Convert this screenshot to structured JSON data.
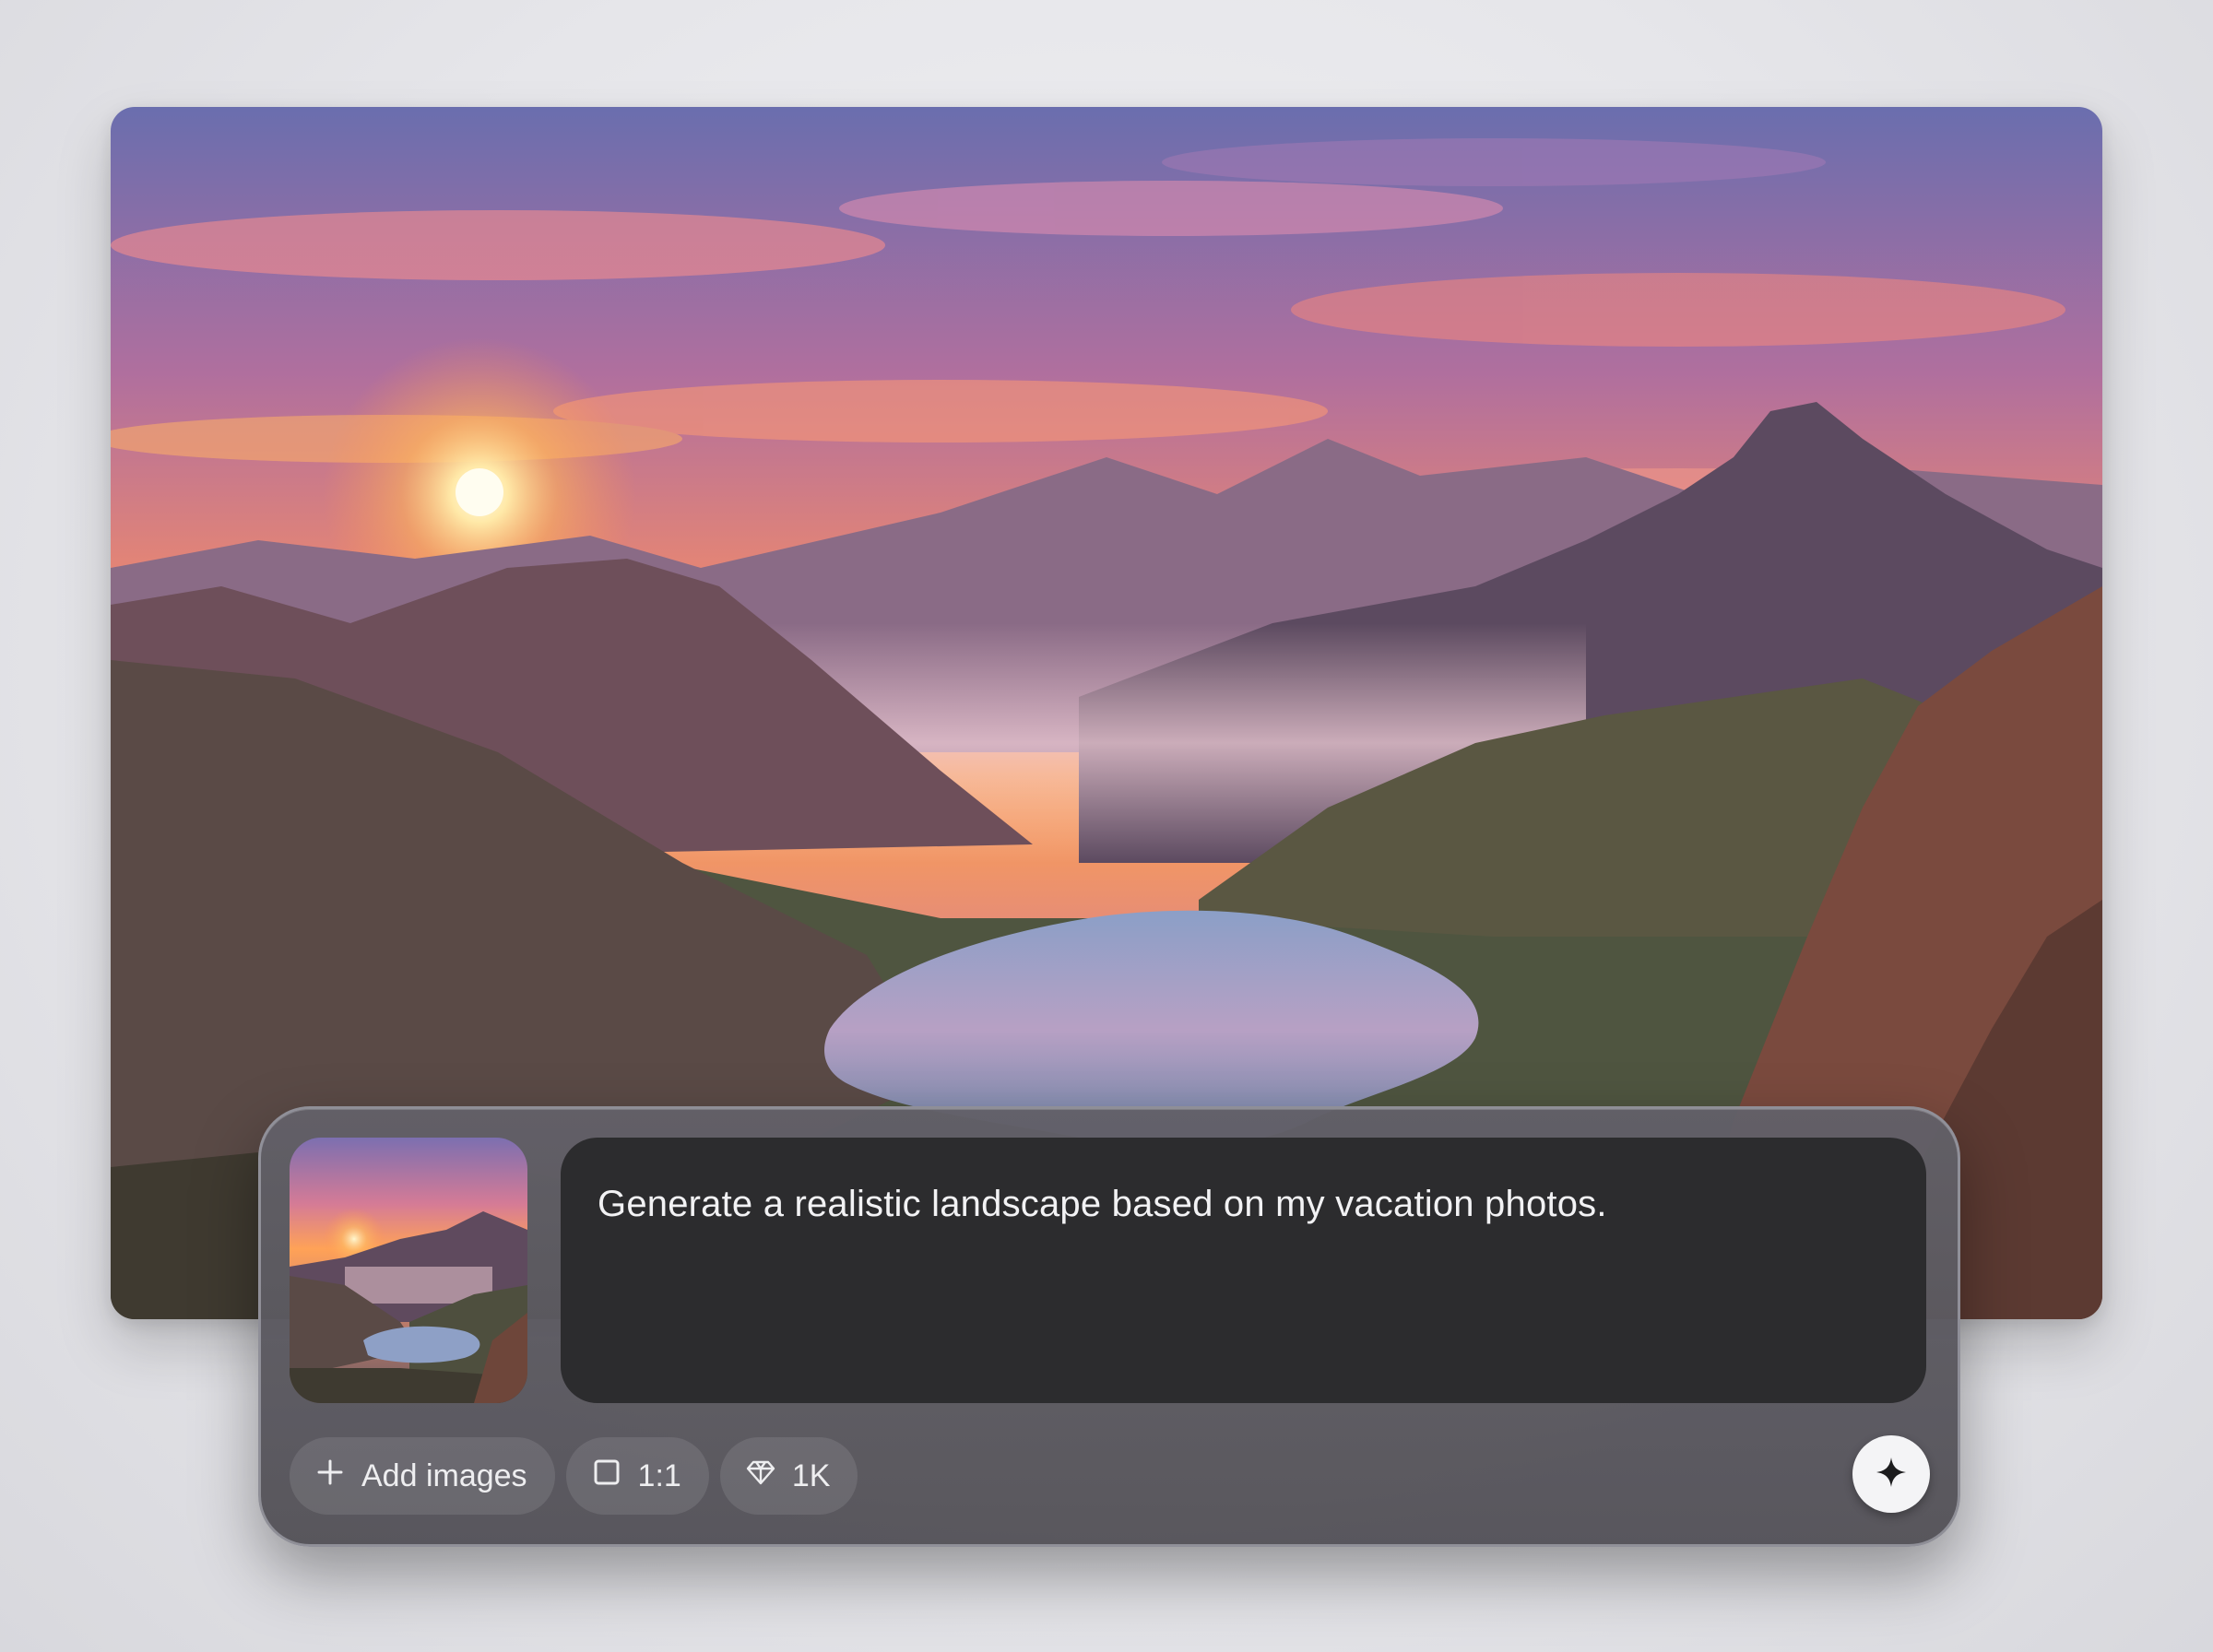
{
  "composer": {
    "prompt_text": "Generate a realistic landscape based on my vacation photos.",
    "attachment_icon": "landscape-thumbnail",
    "toolbar": {
      "add_images_label": "Add images",
      "add_images_icon": "plus-icon",
      "aspect_ratio_label": "1:1",
      "aspect_ratio_icon": "square-icon",
      "quality_label": "1K",
      "quality_icon": "diamond-icon",
      "submit_icon": "sparkle-icon"
    }
  },
  "colors": {
    "panel": "#5c5a62",
    "prompt_box": "#2c2c2e",
    "submit_button": "#f4f4f6"
  }
}
